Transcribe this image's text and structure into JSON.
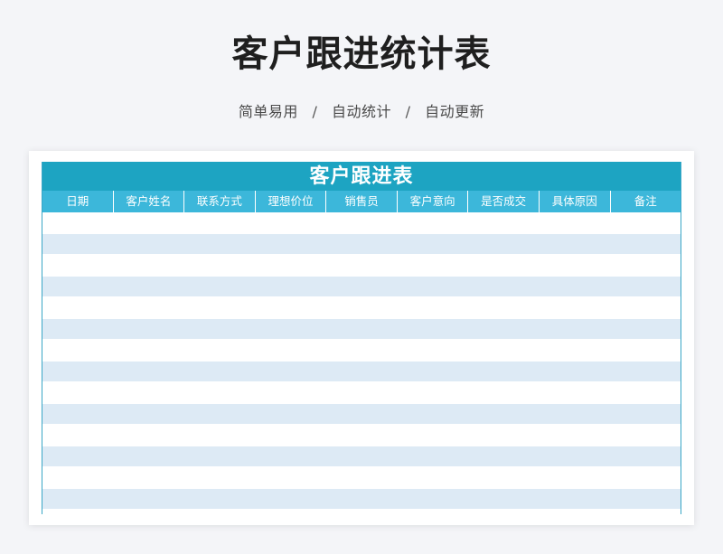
{
  "page": {
    "title": "客户跟进统计表",
    "subtitle_items": [
      "简单易用",
      "自动统计",
      "自动更新"
    ],
    "subtitle_separator": "/"
  },
  "sheet": {
    "title": "客户跟进表",
    "columns": [
      "日期",
      "客户姓名",
      "联系方式",
      "理想价位",
      "销售员",
      "客户意向",
      "是否成交",
      "具体原因",
      "备注"
    ],
    "rows": [
      [
        "",
        "",
        "",
        "",
        "",
        "",
        "",
        "",
        ""
      ],
      [
        "",
        "",
        "",
        "",
        "",
        "",
        "",
        "",
        ""
      ],
      [
        "",
        "",
        "",
        "",
        "",
        "",
        "",
        "",
        ""
      ],
      [
        "",
        "",
        "",
        "",
        "",
        "",
        "",
        "",
        ""
      ],
      [
        "",
        "",
        "",
        "",
        "",
        "",
        "",
        "",
        ""
      ],
      [
        "",
        "",
        "",
        "",
        "",
        "",
        "",
        "",
        ""
      ],
      [
        "",
        "",
        "",
        "",
        "",
        "",
        "",
        "",
        ""
      ],
      [
        "",
        "",
        "",
        "",
        "",
        "",
        "",
        "",
        ""
      ],
      [
        "",
        "",
        "",
        "",
        "",
        "",
        "",
        "",
        ""
      ],
      [
        "",
        "",
        "",
        "",
        "",
        "",
        "",
        "",
        ""
      ],
      [
        "",
        "",
        "",
        "",
        "",
        "",
        "",
        "",
        ""
      ],
      [
        "",
        "",
        "",
        "",
        "",
        "",
        "",
        "",
        ""
      ],
      [
        "",
        "",
        "",
        "",
        "",
        "",
        "",
        "",
        ""
      ],
      [
        "",
        "",
        "",
        "",
        "",
        "",
        "",
        "",
        ""
      ]
    ]
  },
  "colors": {
    "title_bar": "#1da4c2",
    "header_bar": "#3cb7da",
    "row_alt": "#ddeaf5",
    "page_bg": "#f4f5f8"
  }
}
